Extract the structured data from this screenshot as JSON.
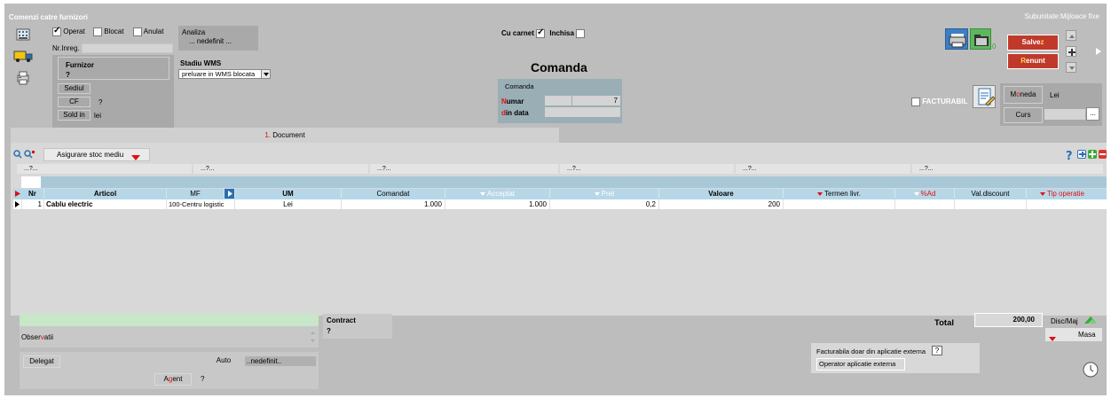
{
  "window": {
    "title": "Comenzi catre furnizori",
    "subunitate": "Subunitate:Mijloace fixe"
  },
  "flags": {
    "operat": "Operat",
    "blocat": "Blocat",
    "anulat": "Anulat",
    "operat_checked": true,
    "blocat_checked": false,
    "anulat_checked": false
  },
  "analiza": {
    "label": "Analiza",
    "value": "... nedefinit ..."
  },
  "nrinreg": {
    "label": "Nr.Inreg."
  },
  "furnizor": {
    "label": "Furnizor",
    "value": "?",
    "sediul_label": "Sediul",
    "cf_label": "CF",
    "cf_value": "?",
    "sold_label": "Sold in",
    "sold_value": "lei"
  },
  "stadiu": {
    "label": "Stadiu WMS",
    "value": "preluare in WMS blocata"
  },
  "carnet": {
    "cu_carnet": "Cu carnet",
    "cu_carnet_checked": true,
    "inchisa": "Inchisa",
    "inchisa_checked": false
  },
  "doc": {
    "title": "Comanda",
    "box_label": "Comanda",
    "numar_label_first": "N",
    "numar_label_rest": "umar",
    "numar_value": "7",
    "data_label_first": "d",
    "data_label_rest": "in data"
  },
  "actions": {
    "count": "0",
    "salvez_main": "Salve",
    "salvez_hot": "z",
    "renunt_hot": "R",
    "renunt_main": "enunt",
    "facturabil": "FACTURABIL"
  },
  "moneda": {
    "label_first": "M",
    "label_hot": "o",
    "label_rest": "neda",
    "value": "Lei",
    "curs_label": "Curs",
    "curs_btn": "..."
  },
  "tabs": [
    {
      "num": "1.",
      "label": " Document"
    }
  ],
  "toolbar": {
    "asigurare": "Asigurare stoc mediu"
  },
  "filters": [
    "...?...",
    "...?...",
    "...?...",
    "...?...",
    "...?...",
    "...?..."
  ],
  "table": {
    "headers": {
      "nr": "Nr",
      "articol": "Articol",
      "mf": "MF",
      "um": "UM",
      "comandat": "Comandat",
      "acceptat": "Acceptat",
      "pret": "Pret",
      "valoare": "Valoare",
      "termen": "Termen livr.",
      "ad": "%Ad",
      "valdiscount": "Val.discount",
      "tipoperatie": "Tip operatie"
    },
    "rows": [
      {
        "nr": "1",
        "articol": "Cablu electric",
        "mf": "100-Centru logistic",
        "um": "Lei",
        "comandat": "1.000",
        "acceptat": "1.000",
        "pret": "0,2",
        "valoare": "200",
        "termen": "",
        "ad": "",
        "valdiscount": "",
        "tipoperatie": ""
      }
    ]
  },
  "footer": {
    "observatii_first": "Obser",
    "observatii_hot": "v",
    "observatii_rest": "atii",
    "contract_label": "Contract",
    "contract_value": "?",
    "delegat": "Delegat",
    "auto_label": "Auto",
    "auto_value": "..nedefinit..",
    "agent_first": "A",
    "agent_hot": "g",
    "agent_rest": "ent",
    "agent_value": "?",
    "total_label": "Total",
    "total_value": "200,00",
    "discmaj": "Disc/Maj",
    "masa": "Masa",
    "fact_ext": "Facturabila doar din aplicatie externa",
    "fact_ext_btn": "?",
    "operator_ext": "Operator aplicatie externa"
  }
}
